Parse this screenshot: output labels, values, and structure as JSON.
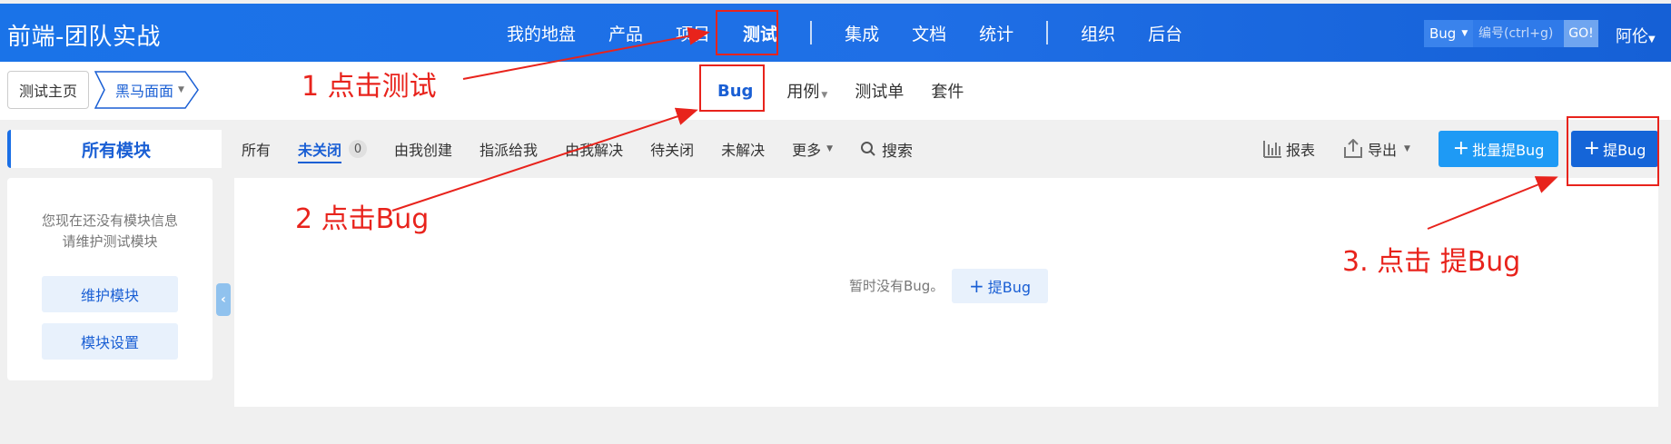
{
  "header": {
    "app_title": "前端-团队实战",
    "nav": [
      "我的地盘",
      "产品",
      "项目"
    ],
    "nav_active": "测试",
    "nav2": [
      "集成",
      "文档",
      "统计"
    ],
    "nav3": [
      "组织",
      "后台"
    ],
    "search_type": "Bug",
    "search_placeholder": "编号(ctrl+g)",
    "search_go": "GO!",
    "user": "阿伦"
  },
  "subheader": {
    "breadcrumb_home": "测试主页",
    "breadcrumb_product": "黑马面面",
    "tabs": {
      "bug": "Bug",
      "case": "用例",
      "testtask": "测试单",
      "suite": "套件"
    }
  },
  "featurebar": {
    "module_tab": "所有模块",
    "filters": {
      "all": "所有",
      "unclosed": "未关闭",
      "unclosed_count": "0",
      "created_by_me": "由我创建",
      "assigned_to_me": "指派给我",
      "resolved_by_me": "由我解决",
      "to_close": "待关闭",
      "unresolved": "未解决",
      "more": "更多",
      "search": "搜索"
    },
    "report": "报表",
    "export": "导出",
    "batch_create": "批量提Bug",
    "create_bug": "提Bug"
  },
  "sidebar": {
    "empty_line1": "您现在还没有模块信息",
    "empty_line2": "请维护测试模块",
    "maintain_module": "维护模块",
    "module_settings": "模块设置"
  },
  "main": {
    "empty_text": "暂时没有Bug。",
    "create_bug": "提Bug"
  },
  "annotations": {
    "step1": "1  点击测试",
    "step2": "2 点击Bug",
    "step3": "3. 点击 提Bug",
    "color": "#e8231c"
  },
  "colors": {
    "header_blue": "#1a73e8",
    "primary": "#1565d8",
    "accent": "#1e9af5"
  }
}
